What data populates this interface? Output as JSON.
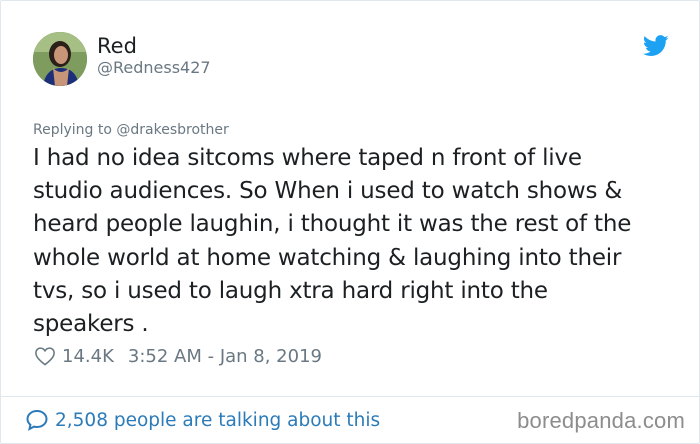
{
  "tweet": {
    "author": {
      "display_name": "Red",
      "handle": "@Redness427",
      "avatar_icon": "avatar-photo"
    },
    "platform_icon": "twitter-bird-icon",
    "reply_to": "Replying to @drakesbrother",
    "text": "I had no idea sitcoms where taped n front of live\nstudio audiences.  So When i used to watch shows &\nheard people laughin, i thought it was the rest of the\nwhole world at home watching & laughing into their\ntvs, so i used to laugh xtra hard right into the\nspeakers .",
    "likes": "14.4K",
    "timestamp": "3:52 AM - Jan 8, 2019"
  },
  "footer": {
    "talking_text": "2,508 people are talking about this",
    "watermark": "boredpanda.com"
  },
  "colors": {
    "twitter_blue": "#1da1f2",
    "link_blue": "#2b7bb9",
    "muted_gray": "#697882",
    "text_dark": "#1c2022",
    "border": "#e1e8ed"
  }
}
